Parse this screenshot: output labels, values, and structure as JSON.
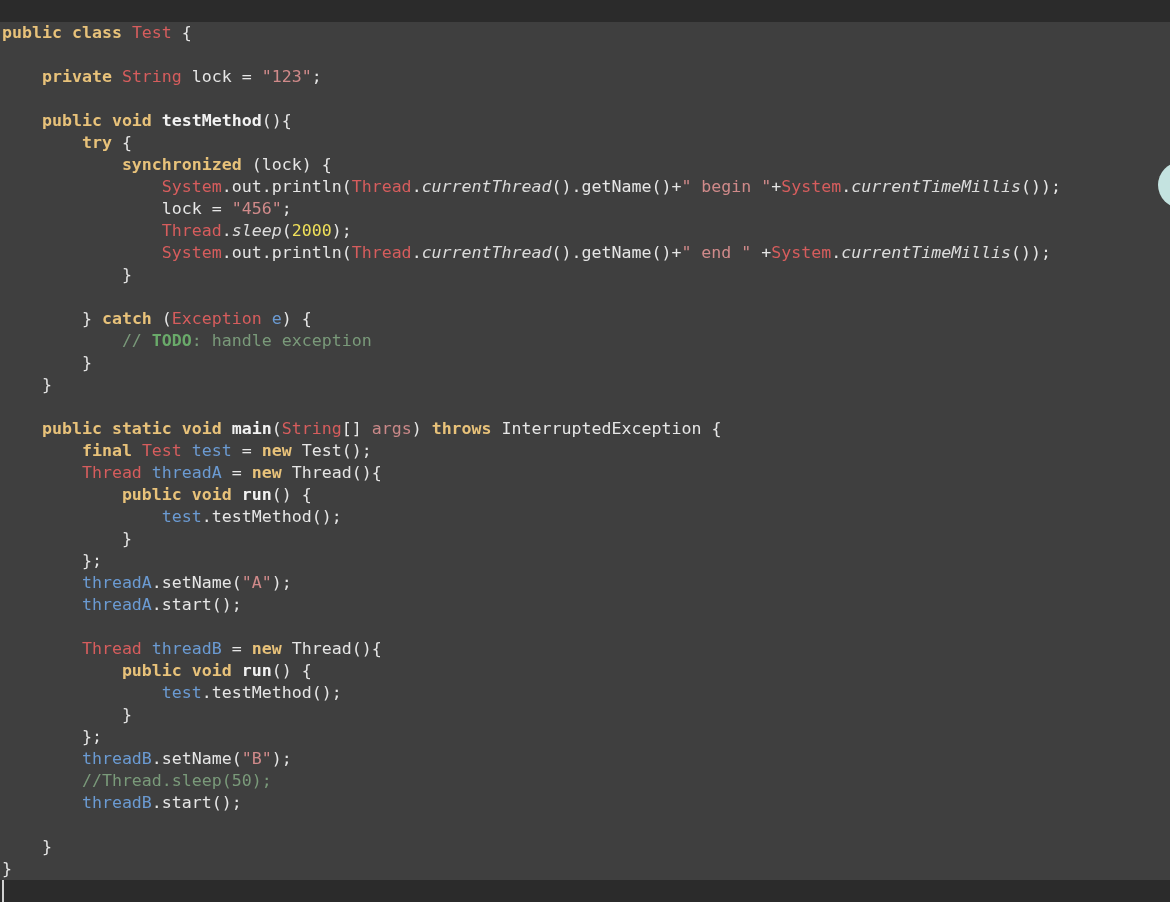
{
  "editor": {
    "lines": [
      {
        "kind": "code",
        "tokens": [
          {
            "kind": "kw",
            "text": "public class "
          },
          {
            "kind": "type",
            "text": "Test"
          },
          {
            "kind": "plain",
            "text": " {"
          }
        ]
      },
      {
        "kind": "blank"
      },
      {
        "kind": "code",
        "tokens": [
          {
            "kind": "kw",
            "text": "    private "
          },
          {
            "kind": "type",
            "text": "String"
          },
          {
            "kind": "plain",
            "text": " lock = "
          },
          {
            "kind": "str",
            "text": "\"123\""
          },
          {
            "kind": "plain",
            "text": ";"
          }
        ]
      },
      {
        "kind": "blank"
      },
      {
        "kind": "code",
        "tokens": [
          {
            "kind": "kw",
            "text": "    public void "
          },
          {
            "kind": "bold",
            "text": "testMethod"
          },
          {
            "kind": "plain",
            "text": "(){"
          }
        ]
      },
      {
        "kind": "code",
        "tokens": [
          {
            "kind": "kw",
            "text": "        try"
          },
          {
            "kind": "plain",
            "text": " {"
          }
        ]
      },
      {
        "kind": "code",
        "tokens": [
          {
            "kind": "kw",
            "text": "            synchronized"
          },
          {
            "kind": "plain",
            "text": " (lock) {"
          }
        ]
      },
      {
        "kind": "code",
        "tokens": [
          {
            "kind": "type",
            "text": "                System"
          },
          {
            "kind": "plain",
            "text": ".out.println("
          },
          {
            "kind": "type",
            "text": "Thread"
          },
          {
            "kind": "plain",
            "text": "."
          },
          {
            "kind": "italic",
            "text": "currentThread"
          },
          {
            "kind": "plain",
            "text": "().getName()+"
          },
          {
            "kind": "str",
            "text": "\" begin \""
          },
          {
            "kind": "plain",
            "text": "+"
          },
          {
            "kind": "type",
            "text": "System"
          },
          {
            "kind": "plain",
            "text": "."
          },
          {
            "kind": "italic",
            "text": "currentTimeMillis"
          },
          {
            "kind": "plain",
            "text": "());"
          }
        ]
      },
      {
        "kind": "code",
        "tokens": [
          {
            "kind": "plain",
            "text": "                lock = "
          },
          {
            "kind": "str",
            "text": "\"456\""
          },
          {
            "kind": "plain",
            "text": ";"
          }
        ]
      },
      {
        "kind": "code",
        "tokens": [
          {
            "kind": "type",
            "text": "                Thread"
          },
          {
            "kind": "plain",
            "text": "."
          },
          {
            "kind": "italic",
            "text": "sleep"
          },
          {
            "kind": "plain",
            "text": "("
          },
          {
            "kind": "num",
            "text": "2000"
          },
          {
            "kind": "plain",
            "text": ");"
          }
        ]
      },
      {
        "kind": "code",
        "tokens": [
          {
            "kind": "type",
            "text": "                System"
          },
          {
            "kind": "plain",
            "text": ".out.println("
          },
          {
            "kind": "type",
            "text": "Thread"
          },
          {
            "kind": "plain",
            "text": "."
          },
          {
            "kind": "italic",
            "text": "currentThread"
          },
          {
            "kind": "plain",
            "text": "().getName()+"
          },
          {
            "kind": "str",
            "text": "\" end \""
          },
          {
            "kind": "plain",
            "text": " +"
          },
          {
            "kind": "type",
            "text": "System"
          },
          {
            "kind": "plain",
            "text": "."
          },
          {
            "kind": "italic",
            "text": "currentTimeMillis"
          },
          {
            "kind": "plain",
            "text": "());"
          }
        ]
      },
      {
        "kind": "code",
        "tokens": [
          {
            "kind": "plain",
            "text": "            }"
          }
        ]
      },
      {
        "kind": "blank"
      },
      {
        "kind": "code",
        "tokens": [
          {
            "kind": "plain",
            "text": "        } "
          },
          {
            "kind": "kw",
            "text": "catch"
          },
          {
            "kind": "plain",
            "text": " ("
          },
          {
            "kind": "type",
            "text": "Exception "
          },
          {
            "kind": "field",
            "text": "e"
          },
          {
            "kind": "plain",
            "text": ") {"
          }
        ]
      },
      {
        "kind": "code",
        "tokens": [
          {
            "kind": "comment",
            "text": "            // "
          },
          {
            "kind": "todo",
            "text": "TODO"
          },
          {
            "kind": "comment",
            "text": ": handle exception"
          }
        ]
      },
      {
        "kind": "code",
        "tokens": [
          {
            "kind": "plain",
            "text": "        }"
          }
        ]
      },
      {
        "kind": "code",
        "tokens": [
          {
            "kind": "plain",
            "text": "    }"
          }
        ]
      },
      {
        "kind": "blank"
      },
      {
        "kind": "code",
        "tokens": [
          {
            "kind": "kw",
            "text": "    public static void "
          },
          {
            "kind": "bold",
            "text": "main"
          },
          {
            "kind": "plain",
            "text": "("
          },
          {
            "kind": "type",
            "text": "String"
          },
          {
            "kind": "plain",
            "text": "[] "
          },
          {
            "kind": "param",
            "text": "args"
          },
          {
            "kind": "plain",
            "text": ") "
          },
          {
            "kind": "kw",
            "text": "throws"
          },
          {
            "kind": "plain",
            "text": " InterruptedException {"
          }
        ]
      },
      {
        "kind": "code",
        "tokens": [
          {
            "kind": "kw",
            "text": "        final "
          },
          {
            "kind": "type",
            "text": "Test "
          },
          {
            "kind": "field",
            "text": "test"
          },
          {
            "kind": "plain",
            "text": " = "
          },
          {
            "kind": "kw",
            "text": "new"
          },
          {
            "kind": "plain",
            "text": " Test();"
          }
        ]
      },
      {
        "kind": "code",
        "tokens": [
          {
            "kind": "type",
            "text": "        Thread "
          },
          {
            "kind": "field",
            "text": "threadA"
          },
          {
            "kind": "plain",
            "text": " = "
          },
          {
            "kind": "kw",
            "text": "new"
          },
          {
            "kind": "plain",
            "text": " Thread(){"
          }
        ]
      },
      {
        "kind": "code",
        "tokens": [
          {
            "kind": "kw",
            "text": "            public void "
          },
          {
            "kind": "bold",
            "text": "run"
          },
          {
            "kind": "plain",
            "text": "() {"
          }
        ]
      },
      {
        "kind": "code",
        "tokens": [
          {
            "kind": "field",
            "text": "                test"
          },
          {
            "kind": "plain",
            "text": ".testMethod();"
          }
        ]
      },
      {
        "kind": "code",
        "tokens": [
          {
            "kind": "plain",
            "text": "            }"
          }
        ]
      },
      {
        "kind": "code",
        "tokens": [
          {
            "kind": "plain",
            "text": "        };"
          }
        ]
      },
      {
        "kind": "code",
        "tokens": [
          {
            "kind": "field",
            "text": "        threadA"
          },
          {
            "kind": "plain",
            "text": ".setName("
          },
          {
            "kind": "str",
            "text": "\"A\""
          },
          {
            "kind": "plain",
            "text": ");"
          }
        ]
      },
      {
        "kind": "code",
        "tokens": [
          {
            "kind": "field",
            "text": "        threadA"
          },
          {
            "kind": "plain",
            "text": ".start();"
          }
        ]
      },
      {
        "kind": "blank"
      },
      {
        "kind": "code",
        "tokens": [
          {
            "kind": "type",
            "text": "        Thread "
          },
          {
            "kind": "field",
            "text": "threadB"
          },
          {
            "kind": "plain",
            "text": " = "
          },
          {
            "kind": "kw",
            "text": "new"
          },
          {
            "kind": "plain",
            "text": " Thread(){"
          }
        ]
      },
      {
        "kind": "code",
        "tokens": [
          {
            "kind": "kw",
            "text": "            public void "
          },
          {
            "kind": "bold",
            "text": "run"
          },
          {
            "kind": "plain",
            "text": "() {"
          }
        ]
      },
      {
        "kind": "code",
        "tokens": [
          {
            "kind": "field",
            "text": "                test"
          },
          {
            "kind": "plain",
            "text": ".testMethod();"
          }
        ]
      },
      {
        "kind": "code",
        "tokens": [
          {
            "kind": "plain",
            "text": "            }"
          }
        ]
      },
      {
        "kind": "code",
        "tokens": [
          {
            "kind": "plain",
            "text": "        };"
          }
        ]
      },
      {
        "kind": "code",
        "tokens": [
          {
            "kind": "field",
            "text": "        threadB"
          },
          {
            "kind": "plain",
            "text": ".setName("
          },
          {
            "kind": "str",
            "text": "\"B\""
          },
          {
            "kind": "plain",
            "text": ");"
          }
        ]
      },
      {
        "kind": "code",
        "tokens": [
          {
            "kind": "comment",
            "text": "        //Thread.sleep(50);"
          }
        ]
      },
      {
        "kind": "code",
        "tokens": [
          {
            "kind": "field",
            "text": "        threadB"
          },
          {
            "kind": "plain",
            "text": ".start();"
          }
        ]
      },
      {
        "kind": "blank"
      },
      {
        "kind": "code",
        "tokens": [
          {
            "kind": "plain",
            "text": "    }"
          }
        ]
      },
      {
        "kind": "code",
        "tokens": [
          {
            "kind": "plain",
            "text": "}"
          }
        ]
      }
    ]
  }
}
